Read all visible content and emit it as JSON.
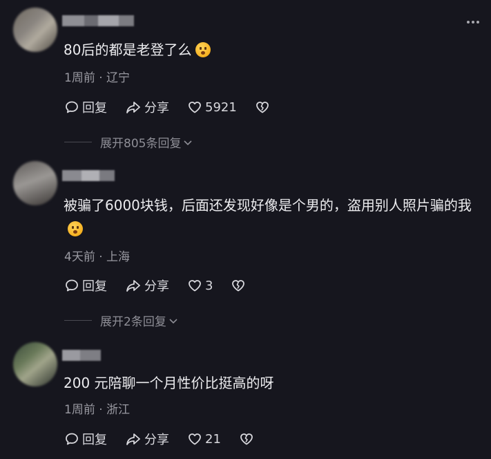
{
  "comments": [
    {
      "text": "80后的都是老登了么",
      "meta": "1周前 · 辽宁",
      "reply_label": "回复",
      "share_label": "分享",
      "likes": "5921",
      "expand_label": "展开805条回复"
    },
    {
      "text": "被骗了6000块钱，后面还发现好像是个男的，盗用别人照片骗的我",
      "meta": "4天前 · 上海",
      "reply_label": "回复",
      "share_label": "分享",
      "likes": "3",
      "expand_label": "展开2条回复"
    },
    {
      "text": "200 元陪聊一个月性价比挺高的呀",
      "meta": "1周前 · 浙江",
      "reply_label": "回复",
      "share_label": "分享",
      "likes": "21"
    }
  ],
  "colors": {
    "background": "#16161e",
    "text": "#ececef",
    "meta": "#9a9aa2"
  }
}
